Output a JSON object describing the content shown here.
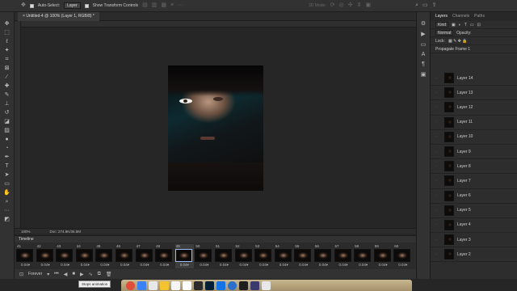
{
  "options_bar": {
    "auto_select_label": "Auto-Select:",
    "auto_select_value": "Layer",
    "transform_label": "Show Transform Controls",
    "mode_label": "3D Mode:"
  },
  "document": {
    "tab_title": "Untitled-4 @ 100% (Layer 1, RGB/8) *",
    "zoom": "100%",
    "doc_info": "Doc: 274.8K/36.5M"
  },
  "timeline": {
    "title": "Timeline",
    "frames": [
      {
        "num": "41",
        "dur": "0.04"
      },
      {
        "num": "42",
        "dur": "0.04"
      },
      {
        "num": "43",
        "dur": "0.04"
      },
      {
        "num": "44",
        "dur": "0.04"
      },
      {
        "num": "45",
        "dur": "0.04"
      },
      {
        "num": "46",
        "dur": "0.04"
      },
      {
        "num": "47",
        "dur": "0.04"
      },
      {
        "num": "48",
        "dur": "0.04"
      },
      {
        "num": "49",
        "dur": "0.04"
      },
      {
        "num": "50",
        "dur": "0.04"
      },
      {
        "num": "51",
        "dur": "0.04"
      },
      {
        "num": "52",
        "dur": "0.04"
      },
      {
        "num": "53",
        "dur": "0.04"
      },
      {
        "num": "54",
        "dur": "0.04"
      },
      {
        "num": "55",
        "dur": "0.04"
      },
      {
        "num": "56",
        "dur": "0.04"
      },
      {
        "num": "57",
        "dur": "0.04"
      },
      {
        "num": "58",
        "dur": "0.04"
      },
      {
        "num": "59",
        "dur": "0.04"
      },
      {
        "num": "60",
        "dur": "0.04"
      }
    ],
    "selected_frame_index": 8,
    "loop_value": "Forever",
    "tooltip": "Stops animation"
  },
  "panel": {
    "tabs": [
      "Layers",
      "Channels",
      "Paths"
    ],
    "active_tab": "Layers",
    "kind_label": "Kind",
    "blend_mode": "Normal",
    "opacity_label": "Opacity:",
    "lock_label": "Lock:",
    "propagate_label": "Propagate Frame 1",
    "layers": [
      "Layer 14",
      "Layer 13",
      "Layer 12",
      "Layer 11",
      "Layer 10",
      "Layer 9",
      "Layer 8",
      "Layer 7",
      "Layer 6",
      "Layer 5",
      "Layer 4",
      "Layer 3",
      "Layer 2"
    ]
  },
  "colors": {
    "accent": "#9bbcff",
    "panel_bg": "#2d2d2d",
    "canvas_bg": "#262626"
  }
}
